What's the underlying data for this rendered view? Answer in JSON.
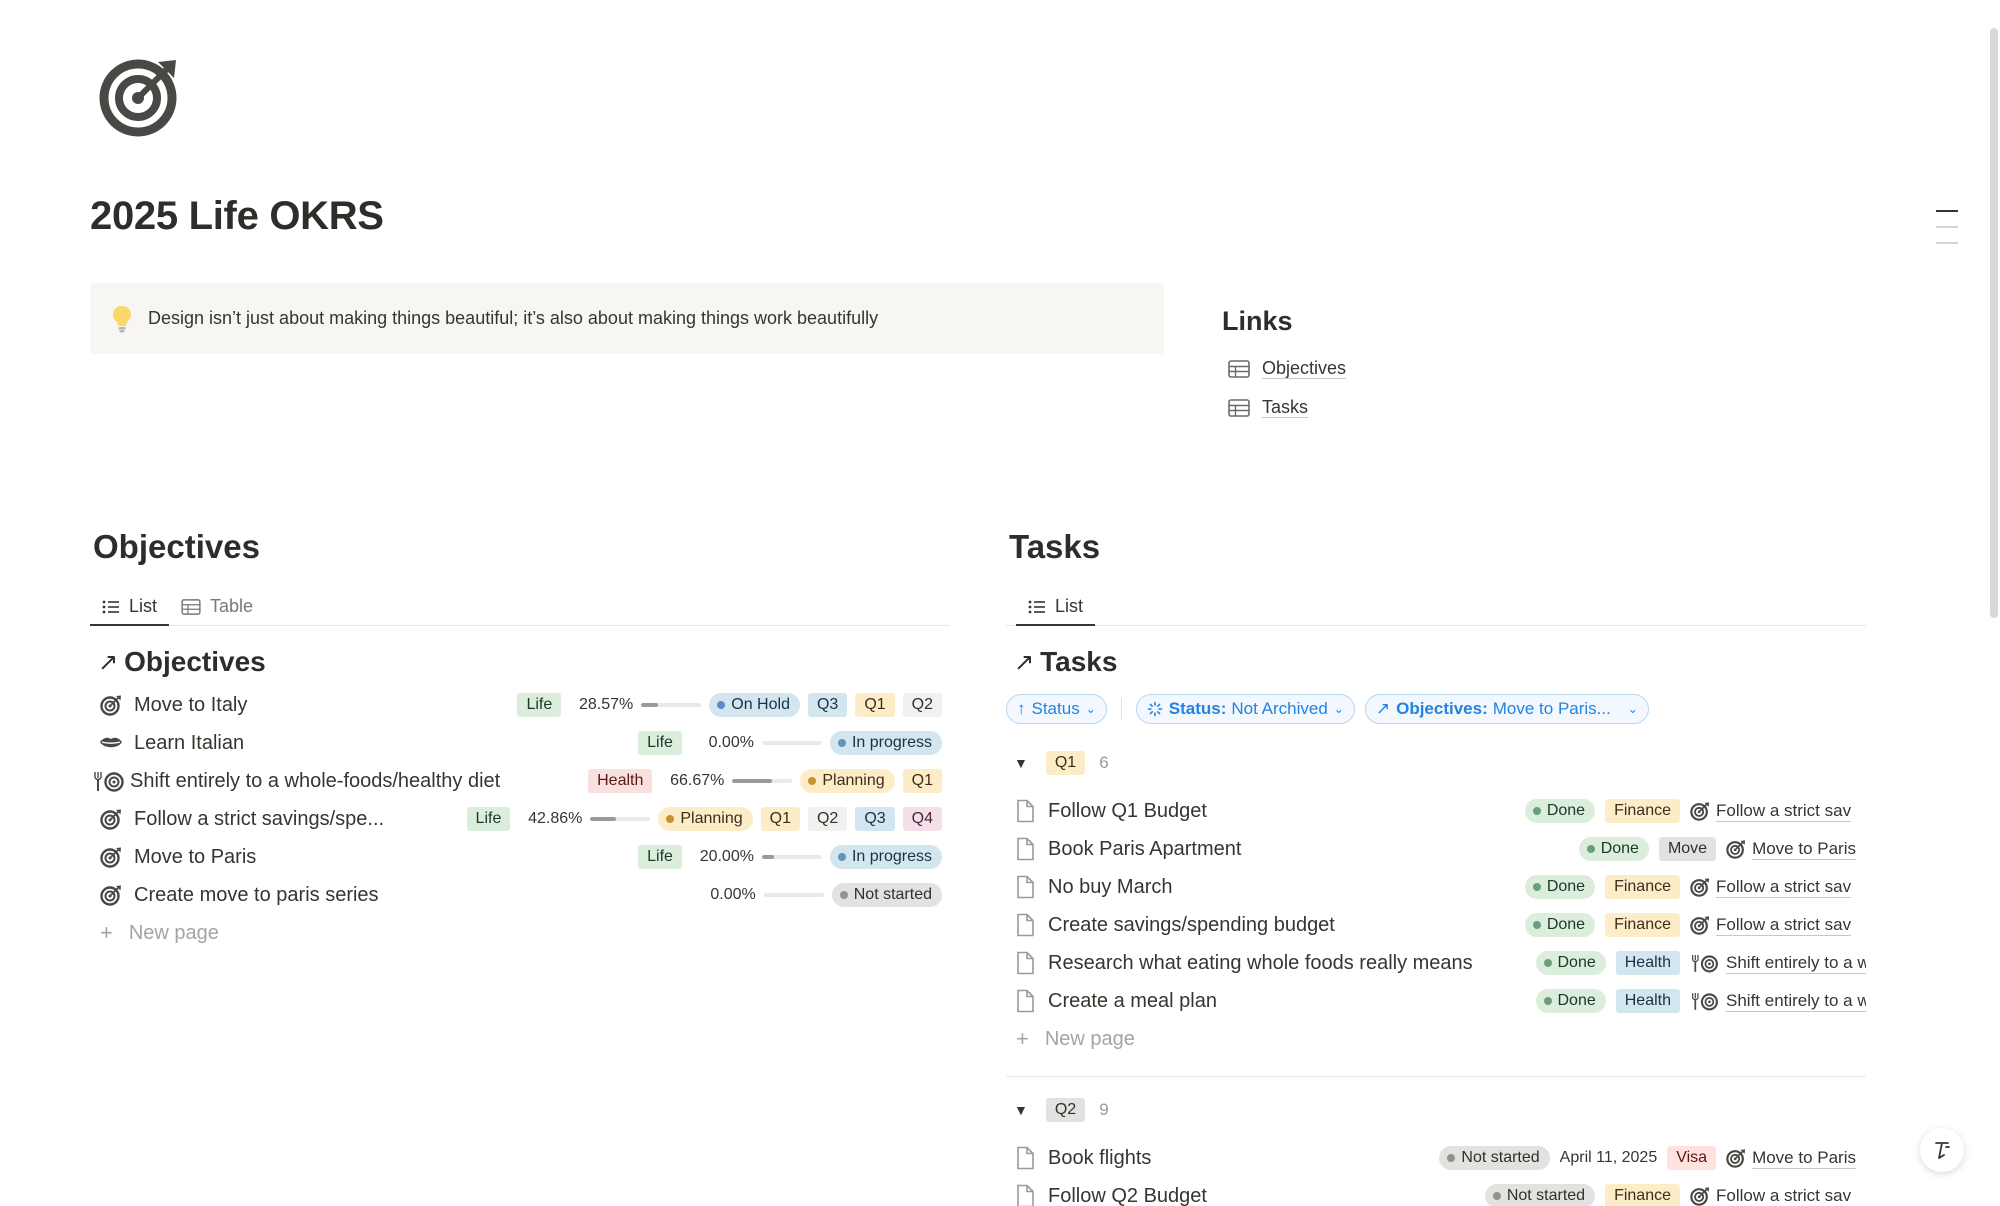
{
  "page": {
    "title": "2025 Life OKRS",
    "icon": "target-icon"
  },
  "callout": {
    "icon": "lightbulb-icon",
    "text": "Design isn’t just about making things beautiful; it’s also about making things work beautifully"
  },
  "links": {
    "heading": "Links",
    "items": [
      {
        "label": "Objectives",
        "icon": "table-icon"
      },
      {
        "label": "Tasks",
        "icon": "table-icon"
      }
    ]
  },
  "objectives": {
    "heading": "Objectives",
    "tabs": [
      {
        "label": "List",
        "icon": "list-icon",
        "active": true
      },
      {
        "label": "Table",
        "icon": "table-icon",
        "active": false
      }
    ],
    "db_title": "Objectives",
    "rows": [
      {
        "name": "Move to Italy",
        "icon": "target-icon",
        "area": "Life",
        "progress": "28.57%",
        "progress_value": 0.2857,
        "status": "On Hold",
        "quarters": [
          "Q3",
          "Q1",
          "Q2"
        ]
      },
      {
        "name": "Learn Italian",
        "icon": "lips-icon",
        "area": "Life",
        "progress": "0.00%",
        "progress_value": 0,
        "status": "In progress",
        "quarters": []
      },
      {
        "name": "Shift entirely to a whole-foods/healthy diet",
        "icon": "fork-plate-icon",
        "area": "Health",
        "progress": "66.67%",
        "progress_value": 0.6667,
        "status": "Planning",
        "quarters": [
          "Q1"
        ]
      },
      {
        "name": "Follow a strict savings/spe...",
        "icon": "target-icon",
        "area": "Life",
        "progress": "42.86%",
        "progress_value": 0.4286,
        "status": "Planning",
        "quarters": [
          "Q1",
          "Q2",
          "Q3",
          "Q4"
        ]
      },
      {
        "name": "Move to Paris",
        "icon": "target-icon",
        "area": "Life",
        "progress": "20.00%",
        "progress_value": 0.2,
        "status": "In progress",
        "quarters": []
      },
      {
        "name": "Create move to paris series",
        "icon": "target-icon",
        "area": "",
        "progress": "0.00%",
        "progress_value": 0,
        "status": "Not started",
        "quarters": []
      }
    ],
    "new_page": "New page"
  },
  "tasks": {
    "heading": "Tasks",
    "tabs": [
      {
        "label": "List",
        "icon": "list-icon",
        "active": true
      }
    ],
    "db_title": "Tasks",
    "filters": {
      "sort": "Status",
      "status_filter_prefix": "Status:",
      "status_filter_value": "Not Archived",
      "objective_filter_prefix": "Objectives:",
      "objective_filter_value": "Move to Paris..."
    },
    "groups": [
      {
        "label": "Q1",
        "count": "6",
        "rows": [
          {
            "name": "Follow Q1 Budget",
            "status": "Done",
            "category": "Finance",
            "objective": "Follow a strict sav",
            "objective_icon": "target-icon"
          },
          {
            "name": "Book Paris Apartment",
            "status": "Done",
            "category": "Move",
            "objective": "Move to Paris",
            "objective_icon": "target-icon"
          },
          {
            "name": "No buy March",
            "status": "Done",
            "category": "Finance",
            "objective": "Follow a strict sav",
            "objective_icon": "target-icon"
          },
          {
            "name": "Create savings/spending budget",
            "status": "Done",
            "category": "Finance",
            "objective": "Follow a strict sav",
            "objective_icon": "target-icon"
          },
          {
            "name": "Research what eating whole foods really means",
            "status": "Done",
            "category": "Health",
            "objective": "Shift entirely to a w",
            "objective_icon": "fork-plate-icon"
          },
          {
            "name": "Create a meal plan",
            "status": "Done",
            "category": "Health",
            "objective": "Shift entirely to a w",
            "objective_icon": "fork-plate-icon"
          }
        ],
        "new_page": "New page"
      },
      {
        "label": "Q2",
        "count": "9",
        "rows": [
          {
            "name": "Book flights",
            "status": "Not started",
            "date": "April 11, 2025",
            "category": "Visa",
            "objective": "Move to Paris",
            "objective_icon": "target-icon"
          },
          {
            "name": "Follow Q2 Budget",
            "status": "Not started",
            "category": "Finance",
            "objective": "Follow a strict sav",
            "objective_icon": "target-icon"
          }
        ]
      }
    ]
  },
  "colors": {
    "text": "#37352f",
    "accent_blue": "#2383e2",
    "callout_bg": "#f7f6f3"
  }
}
